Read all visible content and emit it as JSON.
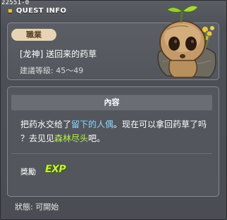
{
  "window": {
    "quest_id": "22551-0",
    "title": "QUEST INFO"
  },
  "info": {
    "job_label": "職業",
    "quest_name": "[龙神]  送回来的药草",
    "required_level": "建議等級: 45～49"
  },
  "npc": {
    "icon": "sprout-creature-npc-icon"
  },
  "content": {
    "header": "內容",
    "line1_before": "把药水交给了",
    "line1_highlight": "留下的人偶",
    "line1_after": "。现在可以拿回药草了吗",
    "line2_before": "？去见见",
    "line2_highlight": "森林尽头",
    "line2_after": "吧。",
    "reward_label": "獎勵",
    "reward_icon_text": "EXP"
  },
  "status": {
    "text": "狀態:  可開始"
  },
  "colors": {
    "highlight_npc": "#8fd6ff",
    "highlight_place": "#b8f04a",
    "title_bullet": "#f0c030",
    "job_badge_bg": "#e8d4b4"
  }
}
